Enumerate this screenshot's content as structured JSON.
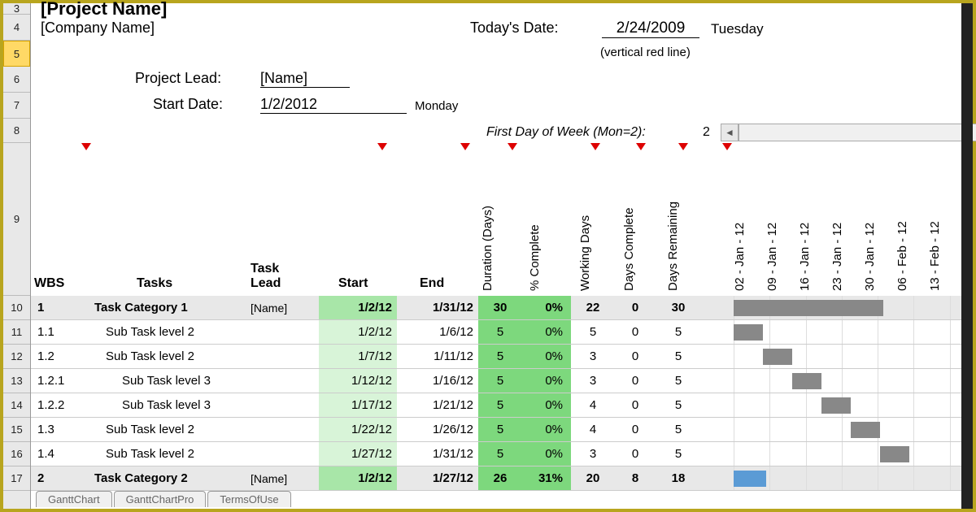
{
  "header": {
    "project_name": "[Project Name]",
    "company_name": "[Company Name]",
    "todays_date_label": "Today's Date:",
    "todays_date_value": "2/24/2009",
    "todays_day_name": "Tuesday",
    "vertical_line_note": "(vertical red line)",
    "project_lead_label": "Project Lead:",
    "project_lead_value": "[Name]",
    "start_date_label": "Start Date:",
    "start_date_value": "1/2/2012",
    "start_day_name": "Monday",
    "first_day_label": "First Day of Week (Mon=2):",
    "first_day_value": "2"
  },
  "row_numbers": [
    "3",
    "4",
    "5",
    "6",
    "7",
    "8",
    "9",
    "10",
    "11",
    "12",
    "13",
    "14",
    "15",
    "16",
    "17"
  ],
  "selected_row": "5",
  "columns": {
    "wbs": "WBS",
    "tasks": "Tasks",
    "task_lead": "Task Lead",
    "start": "Start",
    "end": "End",
    "duration": "Duration (Days)",
    "pct_complete": "% Complete",
    "working_days": "Working Days",
    "days_complete": "Days Complete",
    "days_remaining": "Days Remaining"
  },
  "date_columns": [
    "02 - Jan - 12",
    "09 - Jan - 12",
    "16 - Jan - 12",
    "23 - Jan - 12",
    "30 - Jan - 12",
    "06 - Feb - 12",
    "13 - Feb - 12"
  ],
  "rows": [
    {
      "wbs": "1",
      "task": "Task Category 1",
      "lead": "[Name]",
      "start": "1/2/12",
      "end": "1/31/12",
      "dur": "30",
      "pct": "0%",
      "wd": "22",
      "dc": "0",
      "dr": "30",
      "cat": true,
      "bar_start": 0,
      "bar_span": 4.6,
      "indent": 0
    },
    {
      "wbs": "1.1",
      "task": "Sub Task level 2",
      "lead": "",
      "start": "1/2/12",
      "end": "1/6/12",
      "dur": "5",
      "pct": "0%",
      "wd": "5",
      "dc": "0",
      "dr": "5",
      "cat": false,
      "bar_start": 0,
      "bar_span": 0.9,
      "indent": 1
    },
    {
      "wbs": "1.2",
      "task": "Sub Task level 2",
      "lead": "",
      "start": "1/7/12",
      "end": "1/11/12",
      "dur": "5",
      "pct": "0%",
      "wd": "3",
      "dc": "0",
      "dr": "5",
      "cat": false,
      "bar_start": 0.9,
      "bar_span": 0.9,
      "indent": 1
    },
    {
      "wbs": "1.2.1",
      "task": "Sub Task level 3",
      "lead": "",
      "start": "1/12/12",
      "end": "1/16/12",
      "dur": "5",
      "pct": "0%",
      "wd": "3",
      "dc": "0",
      "dr": "5",
      "cat": false,
      "bar_start": 1.8,
      "bar_span": 0.9,
      "indent": 2
    },
    {
      "wbs": "1.2.2",
      "task": "Sub Task level 3",
      "lead": "",
      "start": "1/17/12",
      "end": "1/21/12",
      "dur": "5",
      "pct": "0%",
      "wd": "4",
      "dc": "0",
      "dr": "5",
      "cat": false,
      "bar_start": 2.7,
      "bar_span": 0.9,
      "indent": 2
    },
    {
      "wbs": "1.3",
      "task": "Sub Task level 2",
      "lead": "",
      "start": "1/22/12",
      "end": "1/26/12",
      "dur": "5",
      "pct": "0%",
      "wd": "4",
      "dc": "0",
      "dr": "5",
      "cat": false,
      "bar_start": 3.6,
      "bar_span": 0.9,
      "indent": 1
    },
    {
      "wbs": "1.4",
      "task": "Sub Task level 2",
      "lead": "",
      "start": "1/27/12",
      "end": "1/31/12",
      "dur": "5",
      "pct": "0%",
      "wd": "3",
      "dc": "0",
      "dr": "5",
      "cat": false,
      "bar_start": 4.5,
      "bar_span": 0.9,
      "indent": 1
    },
    {
      "wbs": "2",
      "task": "Task Category 2",
      "lead": "[Name]",
      "start": "1/2/12",
      "end": "1/27/12",
      "dur": "26",
      "pct": "31%",
      "wd": "20",
      "dc": "8",
      "dr": "18",
      "cat": true,
      "bar_start": 0,
      "bar_span": 1.0,
      "indent": 0,
      "blue": true
    }
  ],
  "tabs": [
    "GanttChart",
    "GanttChartPro",
    "TermsOfUse"
  ]
}
